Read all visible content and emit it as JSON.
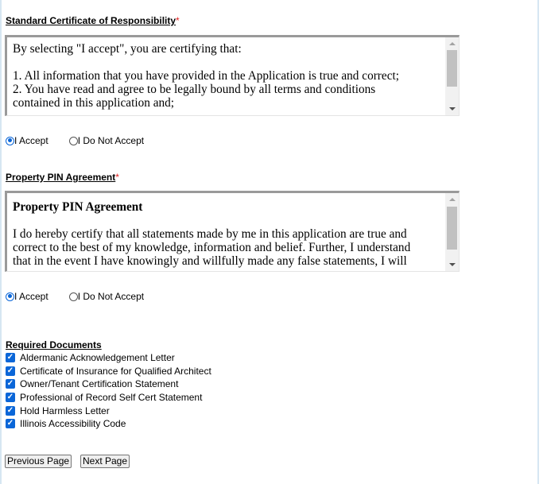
{
  "certificate": {
    "title": "Standard Certificate of Responsibility",
    "required_mark": "*",
    "text_lines": [
      "By selecting \"I accept\", you are certifying that:",
      "",
      "1. All information that you have provided in the Application is true and correct;",
      "2. You have read and agree to be legally bound by all terms and conditions",
      "contained in this application and;"
    ],
    "options": [
      {
        "label": "I Accept",
        "checked": true
      },
      {
        "label": "I Do Not Accept",
        "checked": false
      }
    ]
  },
  "pin_agreement": {
    "title": "Property PIN Agreement",
    "required_mark": "*",
    "heading": "Property PIN Agreement",
    "text_lines": [
      "I do hereby certify that all statements made by me in this application are true and",
      "correct to the best of my knowledge, information and belief. Further, I understand",
      "that in the event I have knowingly and willfully made any false statements, I will"
    ],
    "options": [
      {
        "label": "I Accept",
        "checked": true
      },
      {
        "label": "I Do Not Accept",
        "checked": false
      }
    ]
  },
  "required_documents": {
    "title": "Required Documents",
    "items": [
      {
        "label": "Aldermanic Acknowledgement Letter",
        "checked": true
      },
      {
        "label": "Certificate of Insurance for Qualified Architect",
        "checked": true
      },
      {
        "label": "Owner/Tenant Certification Statement",
        "checked": true
      },
      {
        "label": "Professional of Record Self Cert Statement",
        "checked": true
      },
      {
        "label": "Hold Harmless Letter",
        "checked": true
      },
      {
        "label": "Illinois Accessibility Code",
        "checked": true
      }
    ]
  },
  "nav": {
    "previous_label": "Previous Page",
    "next_label": "Next Page"
  },
  "colors": {
    "accent": "#0a66d8",
    "required": "#e02020",
    "frame": "#d6e6f2"
  }
}
